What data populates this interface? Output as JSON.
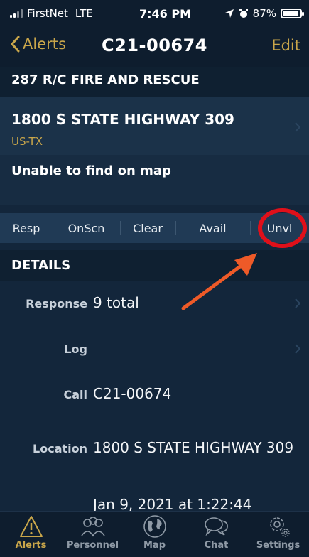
{
  "status_bar": {
    "carrier": "FirstNet",
    "network": "LTE",
    "time": "7:46 PM",
    "battery": "87%",
    "battery_level": 0.87
  },
  "nav": {
    "back_label": "Alerts",
    "title": "C21-00674",
    "edit_label": "Edit"
  },
  "agency": "287 R/C FIRE AND RESCUE",
  "address": {
    "line": "1800 S STATE HIGHWAY 309",
    "state": "US-TX"
  },
  "map_note": "Unable to find on map",
  "status_buttons": [
    "Resp",
    "OnScn",
    "Clear",
    "Avail",
    "Unvl"
  ],
  "details": {
    "header": "DETAILS",
    "rows": [
      {
        "label": "Response",
        "value": "9 total"
      },
      {
        "label": "Log",
        "value": ""
      },
      {
        "label": "Call",
        "value": "C21-00674"
      },
      {
        "label": "Location",
        "value": "1800 S STATE HIGHWAY 309"
      },
      {
        "label": "",
        "value": "Jan 9, 2021 at 1:22:44"
      }
    ]
  },
  "tabs": [
    "Alerts",
    "Personnel",
    "Map",
    "Chat",
    "Settings"
  ],
  "colors": {
    "accent": "#c9a64a",
    "highlight_circle": "#e0101a",
    "arrow": "#ee5a28"
  }
}
